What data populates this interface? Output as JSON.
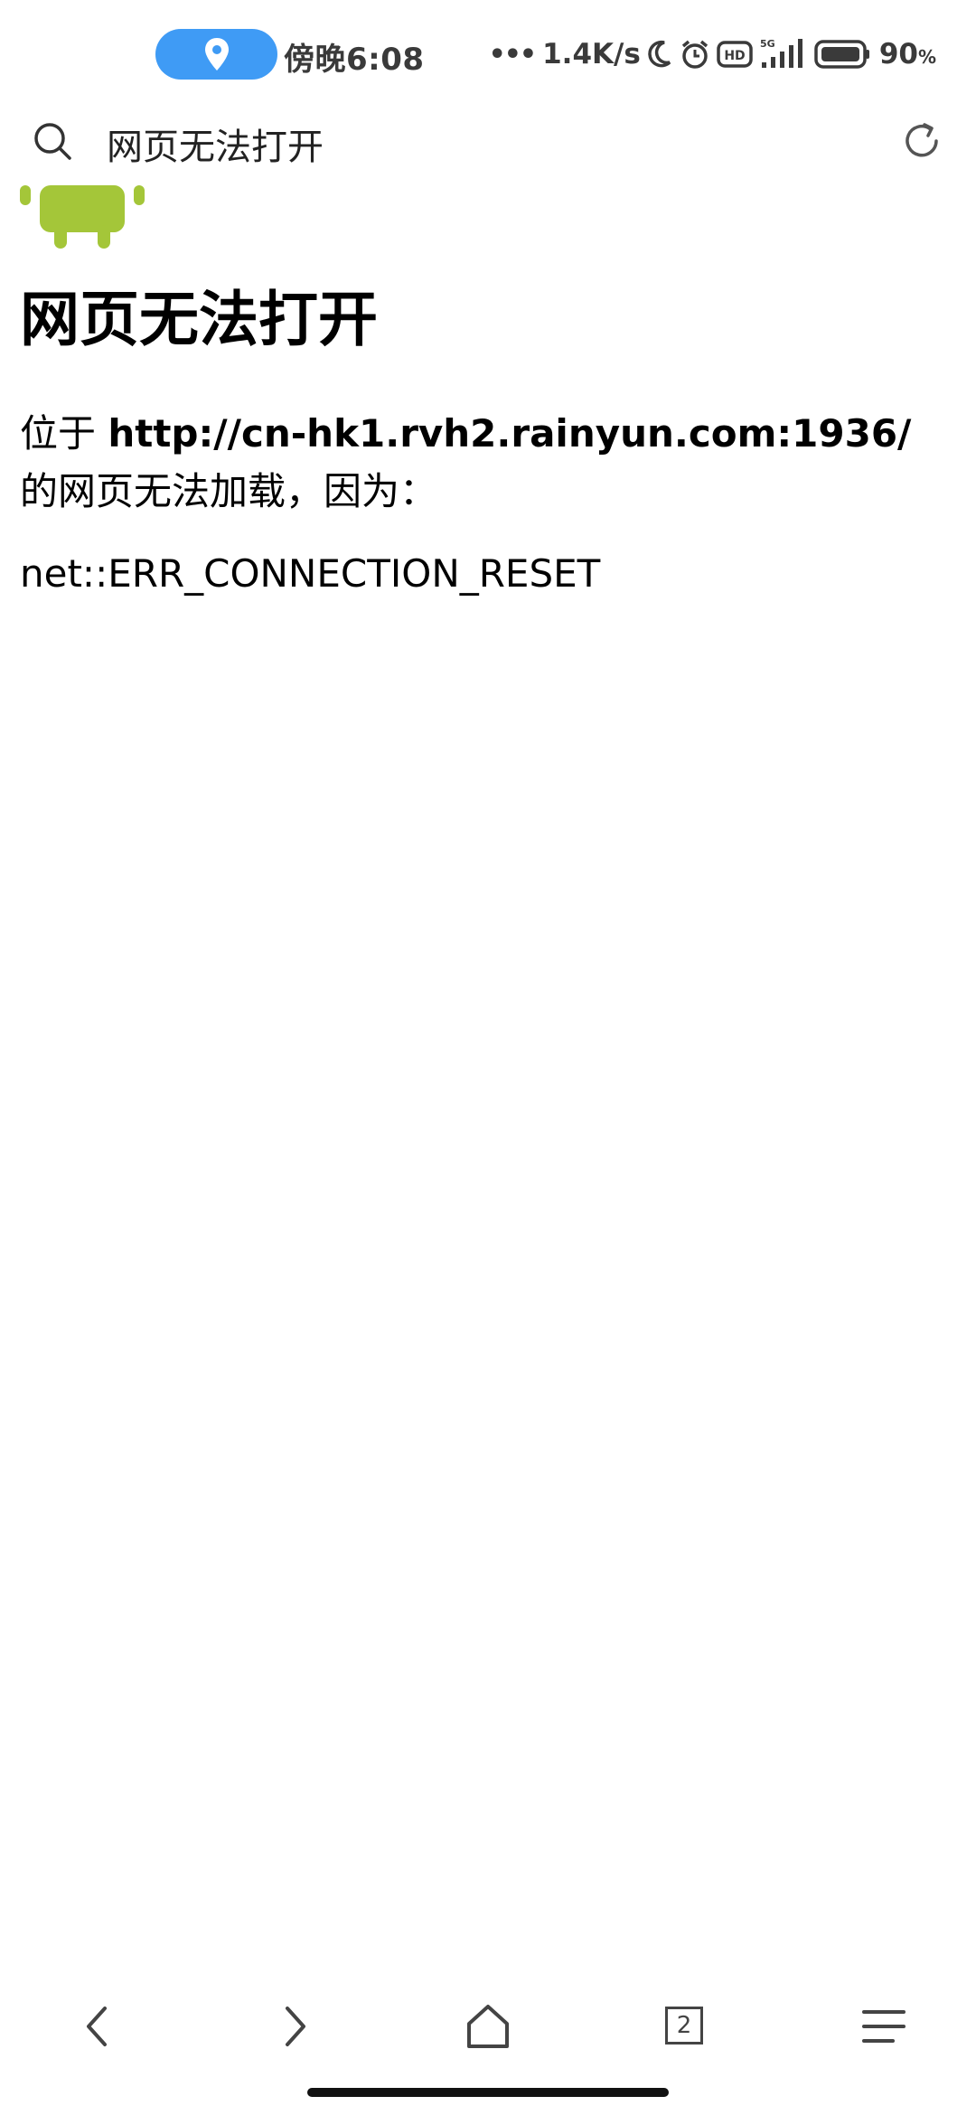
{
  "status_bar": {
    "time": "傍晚6:08",
    "net_speed": "1.4K/s",
    "signal_label": "5G",
    "hd_label": "HD",
    "battery": "90",
    "battery_unit": "%"
  },
  "address_bar": {
    "text": "网页无法打开"
  },
  "error_page": {
    "title": "网页无法打开",
    "desc_prefix": "位于 ",
    "url": "http://cn-hk1.rvh2.rainyun.com:1936/",
    "desc_suffix": " 的网页无法加载，因为：",
    "error_code": "net::ERR_CONNECTION_RESET"
  },
  "toolbar": {
    "tab_count": "2"
  },
  "colors": {
    "location_pill": "#3f9bf5",
    "android_green": "#a4c639"
  }
}
